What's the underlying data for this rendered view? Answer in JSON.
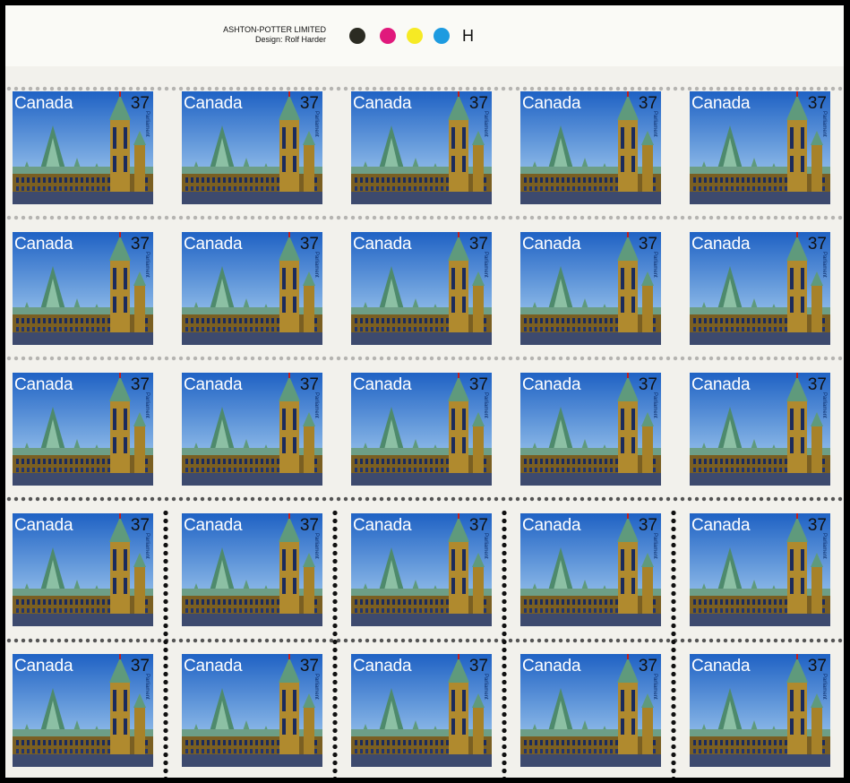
{
  "margin": {
    "printer_line1": "ASHTON-POTTER LIMITED",
    "printer_line2": "Design: Rolf Harder",
    "ink_dots": [
      "#2b2b22",
      "#e0197c",
      "#f6ea24",
      "#1d9be0"
    ],
    "plate_letter": "H"
  },
  "stamp": {
    "country": "Canada",
    "denomination": "37",
    "caption": "Parliament",
    "sky_top": "#1f62c4",
    "sky_bottom": "#b8dcf6",
    "stone": "#b08a2e",
    "roof": "#5f9a7c"
  },
  "pane": {
    "rows": 5,
    "cols": 5
  }
}
